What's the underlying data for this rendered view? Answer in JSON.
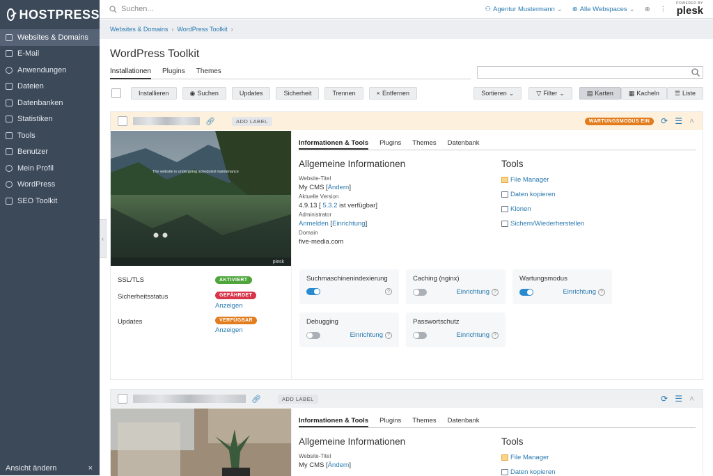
{
  "brand": {
    "name": "HOSTPRESS"
  },
  "sidebar": {
    "items": [
      {
        "label": "Websites & Domains",
        "icon": "monitor-icon",
        "active": true
      },
      {
        "label": "E-Mail",
        "icon": "mail-icon"
      },
      {
        "label": "Anwendungen",
        "icon": "gear-icon"
      },
      {
        "label": "Dateien",
        "icon": "folder-icon"
      },
      {
        "label": "Datenbanken",
        "icon": "database-icon"
      },
      {
        "label": "Statistiken",
        "icon": "chart-icon"
      },
      {
        "label": "Tools",
        "icon": "sliders-icon"
      },
      {
        "label": "Benutzer",
        "icon": "user-icon"
      },
      {
        "label": "Mein Profil",
        "icon": "profile-icon"
      },
      {
        "label": "WordPress",
        "icon": "wordpress-icon"
      },
      {
        "label": "SEO Toolkit",
        "icon": "seo-icon"
      }
    ],
    "bottom_label": "Ansicht ändern",
    "bottom_close": "×"
  },
  "topbar": {
    "search_placeholder": "Suchen...",
    "user": "Agentur Mustermann",
    "webspaces": "Alle Webspaces",
    "plesk_powered": "POWERED BY",
    "plesk_name": "plesk"
  },
  "breadcrumb": {
    "items": [
      "Websites & Domains",
      "WordPress Toolkit"
    ]
  },
  "page": {
    "title": "WordPress Toolkit"
  },
  "main_tabs": [
    "Installationen",
    "Plugins",
    "Themes"
  ],
  "toolbar": {
    "left": [
      "Installieren",
      "Suchen",
      "Updates",
      "Sicherheit",
      "Trennen",
      "Entfernen"
    ],
    "sort": "Sortieren",
    "filter": "Filter",
    "views": [
      "Karten",
      "Kacheln",
      "Liste"
    ]
  },
  "card1": {
    "add_label": "ADD LABEL",
    "status_badge": "WARTUNGSMODUS EIN",
    "preview_text": "The website is undergoing scheduled maintenance",
    "preview_brand": "plesk",
    "sub_tabs": [
      "Informationen & Tools",
      "Plugins",
      "Themes",
      "Datenbank"
    ],
    "info_title": "Allgemeine Informationen",
    "site_title_label": "Website-Titel",
    "site_title_value": "My CMS",
    "change_link": "Ändern",
    "version_label": "Aktuelle Version",
    "version_value": "4.9.13",
    "version_new": "5.3.2",
    "version_suffix": "ist verfügbar",
    "admin_label": "Administrator",
    "admin_login": "Anmelden",
    "admin_setup": "Einrichtung",
    "domain_label": "Domain",
    "domain_value": "five-media.com",
    "tools_title": "Tools",
    "tools": [
      "File Manager",
      "Daten kopieren",
      "Klonen",
      "Sichern/Wiederherstellen"
    ],
    "ssl_label": "SSL/TLS",
    "ssl_badge": "AKTIVIERT",
    "security_label": "Sicherheitsstatus",
    "security_badge": "GEFÄHRDET",
    "security_link": "Anzeigen",
    "updates_label": "Updates",
    "updates_badge": "VERFÜGBAR",
    "updates_link": "Anzeigen",
    "features": [
      {
        "name": "Suchmaschinenindexierung",
        "on": true,
        "setup": ""
      },
      {
        "name": "Caching (nginx)",
        "on": false,
        "setup": "Einrichtung"
      },
      {
        "name": "Wartungsmodus",
        "on": true,
        "setup": "Einrichtung"
      },
      {
        "name": "Debugging",
        "on": false,
        "setup": "Einrichtung"
      },
      {
        "name": "Passwortschutz",
        "on": false,
        "setup": "Einrichtung"
      }
    ]
  },
  "card2": {
    "add_label": "ADD LABEL",
    "sub_tabs": [
      "Informationen & Tools",
      "Plugins",
      "Themes",
      "Datenbank"
    ],
    "info_title": "Allgemeine Informationen",
    "site_title_label": "Website-Titel",
    "site_title_value": "My CMS",
    "change_link": "Ändern",
    "tools_title": "Tools",
    "tools": [
      "File Manager",
      "Daten kopieren"
    ]
  },
  "colors": {
    "sidebar": "#3c4959",
    "accent": "#2a7ab0",
    "warning": "#e27c1c",
    "danger": "#d8344a",
    "success": "#4ea53b"
  }
}
